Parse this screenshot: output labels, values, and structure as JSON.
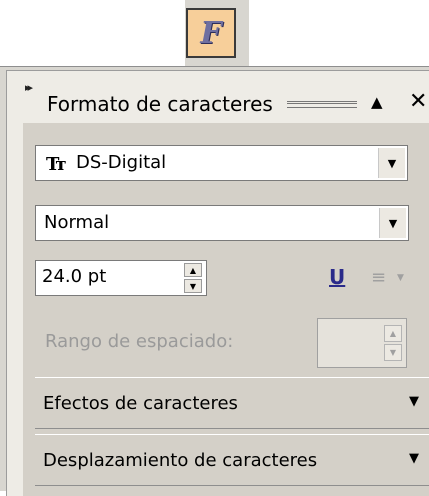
{
  "toolbar": {
    "button_glyph": "F"
  },
  "panel": {
    "title": "Formato de caracteres",
    "collapse_glyph": "▲",
    "close_glyph": "✕"
  },
  "font": {
    "family_value": "DS-Digital",
    "style_value": "Normal",
    "size_value": "24.0 pt"
  },
  "spacing": {
    "label": "Rango de espaciado:"
  },
  "sections": {
    "effects_label": "Efectos de caracteres",
    "offset_label": "Desplazamiento de caracteres"
  },
  "icons": {
    "font_type": "Tт",
    "underline": "U",
    "align": "≡"
  }
}
